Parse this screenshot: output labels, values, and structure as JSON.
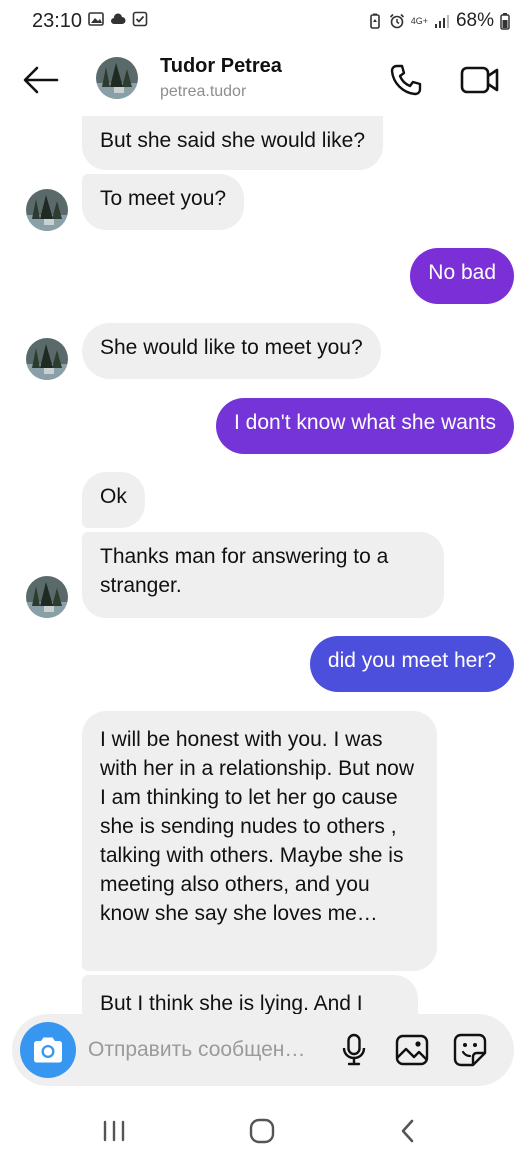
{
  "status_bar": {
    "time": "23:10",
    "network": "4G+",
    "battery": "68%",
    "left_icons": [
      "gallery-icon",
      "cloud-icon",
      "checkbox-icon"
    ],
    "right_icons": [
      "battery-saver-icon",
      "alarm-icon",
      "network-icon",
      "signal-icon",
      "battery-icon"
    ]
  },
  "header": {
    "name": "Tudor Petrea",
    "username": "petrea.tudor",
    "icons": [
      "back-arrow-icon",
      "phone-icon",
      "video-camera-icon"
    ]
  },
  "messages": [
    {
      "side": "in",
      "text": "But she said she would like?",
      "avatar": false
    },
    {
      "side": "in",
      "text": "To meet you?",
      "avatar": true
    },
    {
      "side": "out",
      "text": "No bad",
      "color": "#7b2fd6"
    },
    {
      "side": "in",
      "text": "She would like to meet you?",
      "avatar": true
    },
    {
      "side": "out",
      "text": "I don't know what she wants",
      "color": "#7534d8"
    },
    {
      "side": "in",
      "text": "Ok",
      "avatar": false
    },
    {
      "side": "in",
      "text": "Thanks man for answering to a stranger.",
      "avatar": true
    },
    {
      "side": "out",
      "text": "did you meet her?",
      "color": "#4c4fdc"
    },
    {
      "side": "in",
      "text": "I will be honest with you. I was with her in a relationship. But now I am thinking to let her go cause she is sending nudes to others , talking with others. Maybe she is meeting also others, and you know she say she loves me…",
      "avatar": false
    },
    {
      "side": "in",
      "text": "But I think she is lying. And I",
      "avatar": false
    }
  ],
  "composer": {
    "placeholder": "Отправить сообщен…",
    "icons": [
      "camera-icon",
      "microphone-icon",
      "image-icon",
      "sticker-icon"
    ]
  },
  "nav": {
    "icons": [
      "recent-apps-icon",
      "home-icon",
      "back-icon"
    ]
  },
  "colors": {
    "incoming_bubble": "#efefef",
    "accent_blue": "#3797f0"
  }
}
